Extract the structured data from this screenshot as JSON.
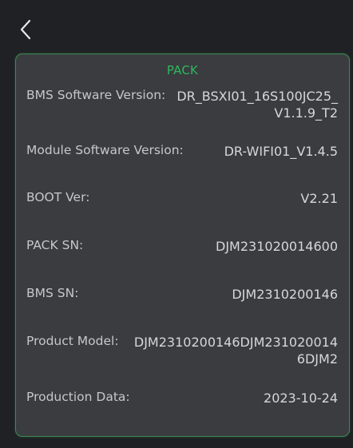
{
  "header": {
    "back_icon": "chevron-left-icon"
  },
  "card": {
    "title": "PACK",
    "accent_color": "#2fb85c",
    "rows": [
      {
        "label": "BMS Software Version:",
        "value": "DR_BSXI01_16S100JC25_\nV1.1.9_T2"
      },
      {
        "label": "Module Software Version:",
        "value": "DR-WIFI01_V1.4.5"
      },
      {
        "label": "BOOT Ver:",
        "value": "V2.21"
      },
      {
        "label": "PACK SN:",
        "value": "DJM231020014600"
      },
      {
        "label": "BMS SN:",
        "value": "DJM2310200146"
      },
      {
        "label": "Product Model:",
        "value": "DJM2310200146DJM231020014\n6DJM2"
      },
      {
        "label": "Production Data:",
        "value": "2023-10-24"
      }
    ]
  }
}
